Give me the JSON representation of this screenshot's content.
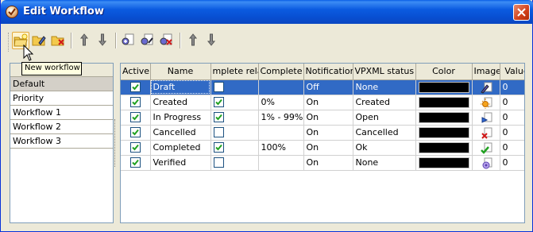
{
  "window": {
    "title": "Edit Workflow"
  },
  "tooltip": {
    "text": "New workflow"
  },
  "toolbar": {
    "buttons": [
      {
        "name": "new-workflow-icon"
      },
      {
        "name": "edit-workflow-icon"
      },
      {
        "name": "delete-workflow-icon"
      },
      {
        "name": "arrow-up-icon"
      },
      {
        "name": "arrow-down-icon"
      },
      {
        "name": "add-status-icon"
      },
      {
        "name": "edit-status-icon"
      },
      {
        "name": "delete-status-icon"
      },
      {
        "name": "arrow-up-icon"
      },
      {
        "name": "arrow-down-icon"
      }
    ]
  },
  "workflows": {
    "header": "",
    "items": [
      "Default",
      "Priority",
      "Workflow 1",
      "Workflow 2",
      "Workflow 3"
    ],
    "selected": "Default"
  },
  "grid": {
    "columns": [
      "Active",
      "Name",
      "mplete relat",
      "Complete",
      "Notification",
      "VPXML status",
      "Color",
      "Image",
      "Value"
    ],
    "rows": [
      {
        "active": true,
        "name": "Draft",
        "complete_rel": false,
        "complete": "",
        "notification": "Off",
        "vpxml": "None",
        "color": "#000000",
        "image": "pen-icon",
        "value": "0"
      },
      {
        "active": true,
        "name": "Created",
        "complete_rel": true,
        "complete": "0%",
        "notification": "On",
        "vpxml": "Created",
        "color": "#000000",
        "image": "sun-icon",
        "value": "0"
      },
      {
        "active": true,
        "name": "In Progress",
        "complete_rel": true,
        "complete": "1% - 99%",
        "notification": "On",
        "vpxml": "Open",
        "color": "#000000",
        "image": "play-icon",
        "value": "0"
      },
      {
        "active": true,
        "name": "Cancelled",
        "complete_rel": false,
        "complete": "",
        "notification": "On",
        "vpxml": "Cancelled",
        "color": "#000000",
        "image": "cross-icon",
        "value": "0"
      },
      {
        "active": true,
        "name": "Completed",
        "complete_rel": true,
        "complete": "100%",
        "notification": "On",
        "vpxml": "Ok",
        "color": "#000000",
        "image": "check-icon",
        "value": "0"
      },
      {
        "active": true,
        "name": "Verified",
        "complete_rel": false,
        "complete": "",
        "notification": "On",
        "vpxml": "None",
        "color": "#000000",
        "image": "target-icon",
        "value": "0"
      }
    ]
  },
  "colors": {
    "selection": "#316ac5",
    "titlebar": "#0a5fe6",
    "checkmark": "#21a121"
  }
}
